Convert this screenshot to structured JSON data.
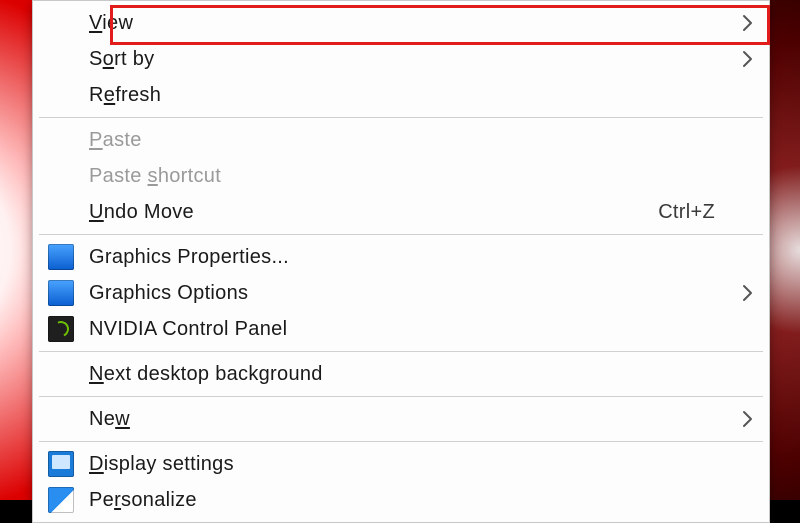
{
  "highlight": {
    "target_index": 0
  },
  "menu": {
    "groups": [
      [
        {
          "pre": "",
          "mk": "V",
          "post": "iew",
          "submenu": true,
          "enabled": true,
          "icon": null
        },
        {
          "pre": "S",
          "mk": "o",
          "post": "rt by",
          "submenu": true,
          "enabled": true,
          "icon": null
        },
        {
          "pre": "R",
          "mk": "e",
          "post": "fresh",
          "submenu": false,
          "enabled": true,
          "icon": null
        }
      ],
      [
        {
          "pre": "",
          "mk": "P",
          "post": "aste",
          "submenu": false,
          "enabled": false,
          "icon": null
        },
        {
          "pre": "Paste ",
          "mk": "s",
          "post": "hortcut",
          "submenu": false,
          "enabled": false,
          "icon": null
        },
        {
          "pre": "",
          "mk": "U",
          "post": "ndo Move",
          "submenu": false,
          "enabled": true,
          "icon": null,
          "accel": "Ctrl+Z"
        }
      ],
      [
        {
          "pre": "",
          "mk": "",
          "post": "Graphics Properties...",
          "submenu": false,
          "enabled": true,
          "icon": "intel"
        },
        {
          "pre": "",
          "mk": "",
          "post": "Graphics Options",
          "submenu": true,
          "enabled": true,
          "icon": "intel"
        },
        {
          "pre": "",
          "mk": "",
          "post": "NVIDIA Control Panel",
          "submenu": false,
          "enabled": true,
          "icon": "nvidia"
        }
      ],
      [
        {
          "pre": "",
          "mk": "N",
          "post": "ext desktop background",
          "submenu": false,
          "enabled": true,
          "icon": null
        }
      ],
      [
        {
          "pre": "Ne",
          "mk": "w",
          "post": "",
          "submenu": true,
          "enabled": true,
          "icon": null
        }
      ],
      [
        {
          "pre": "",
          "mk": "D",
          "post": "isplay settings",
          "submenu": false,
          "enabled": true,
          "icon": "display"
        },
        {
          "pre": "Pe",
          "mk": "r",
          "post": "sonalize",
          "submenu": false,
          "enabled": true,
          "icon": "personalize"
        }
      ]
    ]
  }
}
